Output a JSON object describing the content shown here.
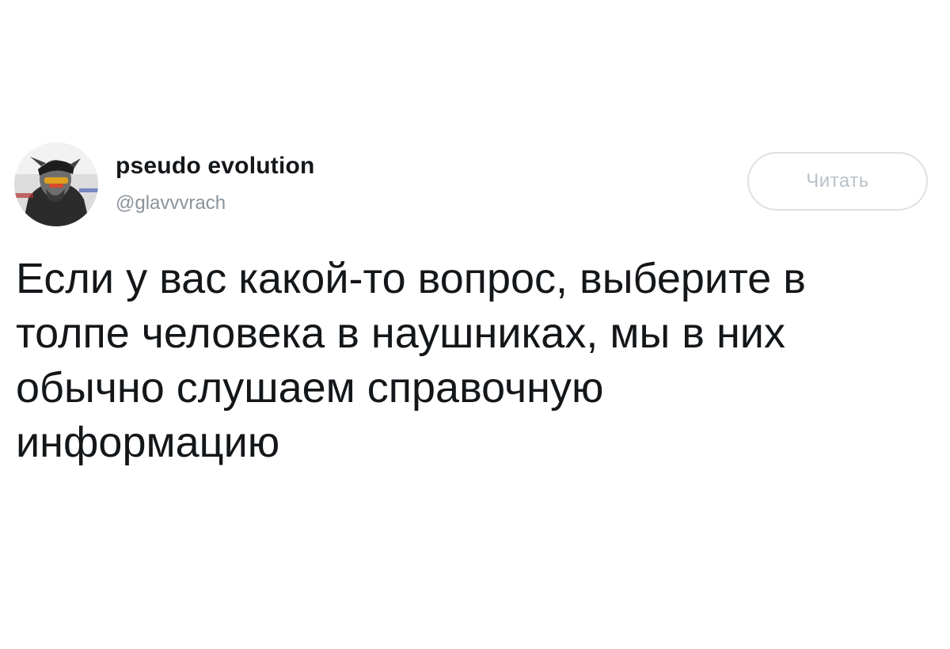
{
  "tweet": {
    "author": {
      "display_name": "pseudo evolution",
      "handle": "@glavvvrach",
      "avatar_icon": "user-avatar"
    },
    "follow_button": {
      "label": "Читать"
    },
    "text_lines": [
      "Если у вас какой-то вопрос, выберите в",
      "толпе человека в наушниках, мы в них",
      "обычно слушаем справочную",
      "информацию"
    ]
  },
  "colors": {
    "text_primary": "#14171a",
    "text_secondary": "#8a939b",
    "button_border": "#dbe1e6",
    "button_text": "#b9c2c9",
    "background": "#ffffff"
  }
}
